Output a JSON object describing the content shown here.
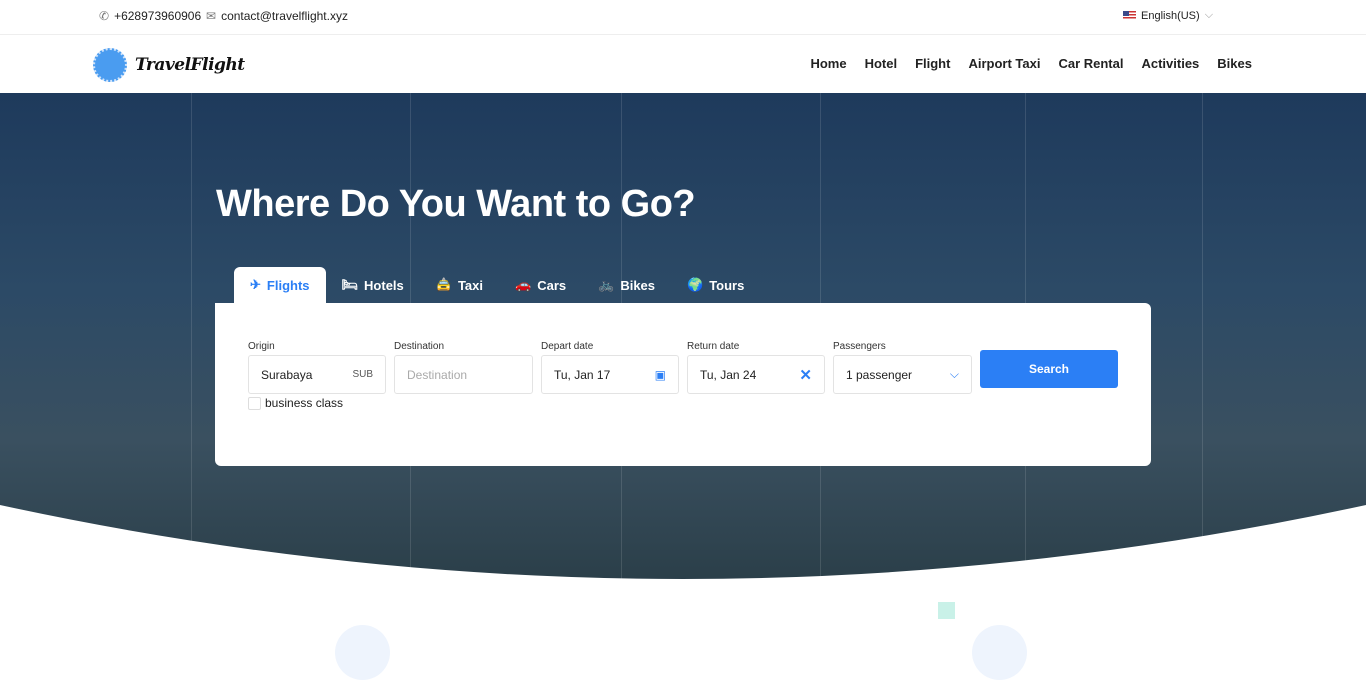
{
  "topbar": {
    "phone": "+628973960906",
    "email": "contact@travelflight.xyz",
    "language": "English(US)"
  },
  "brand": {
    "name": "TravelFlight"
  },
  "nav": [
    "Home",
    "Hotel",
    "Flight",
    "Airport Taxi",
    "Car Rental",
    "Activities",
    "Bikes"
  ],
  "hero": {
    "title": "Where Do You Want to Go?"
  },
  "tabs": [
    "Flights",
    "Hotels",
    "Taxi",
    "Cars",
    "Bikes",
    "Tours"
  ],
  "form": {
    "origin": {
      "label": "Origin",
      "value": "Surabaya",
      "code": "SUB"
    },
    "destination": {
      "label": "Destination",
      "placeholder": "Destination"
    },
    "depart": {
      "label": "Depart date",
      "value": "Tu, Jan 17"
    },
    "return": {
      "label": "Return date",
      "value": "Tu, Jan 24"
    },
    "passengers": {
      "label": "Passengers",
      "value": "1 passenger"
    },
    "search": "Search",
    "business": "business class"
  },
  "colors": {
    "accent": "#2b7ff5"
  }
}
